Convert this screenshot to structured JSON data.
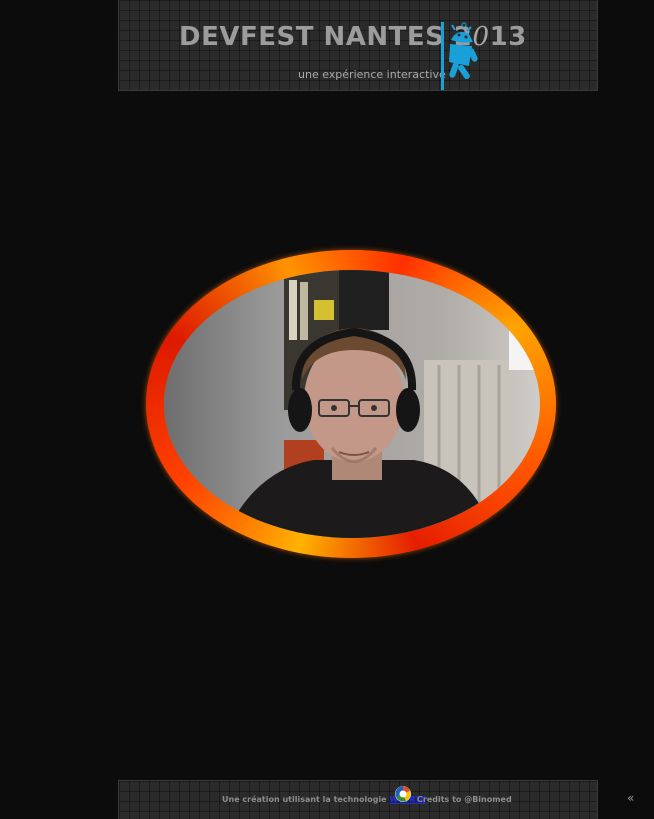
{
  "header": {
    "title_main": "DEVFEST NANTES 2",
    "title_zero": "0",
    "title_end": "13",
    "subtitle": "une expérience interactive",
    "mascot_icon": "android-mascot-icon"
  },
  "stage": {
    "frame_colors": [
      "#e01010",
      "#ff6a00",
      "#ffb000"
    ]
  },
  "footer": {
    "creation_text": "Une création utilisant la technologie",
    "tech_link": "WebRTC",
    "credits_text": "Credits to @Binomed",
    "tech_icon": "html5-logo-icon"
  },
  "side_toggle": {
    "icon": "chevron-left-icon",
    "glyph": "«"
  }
}
